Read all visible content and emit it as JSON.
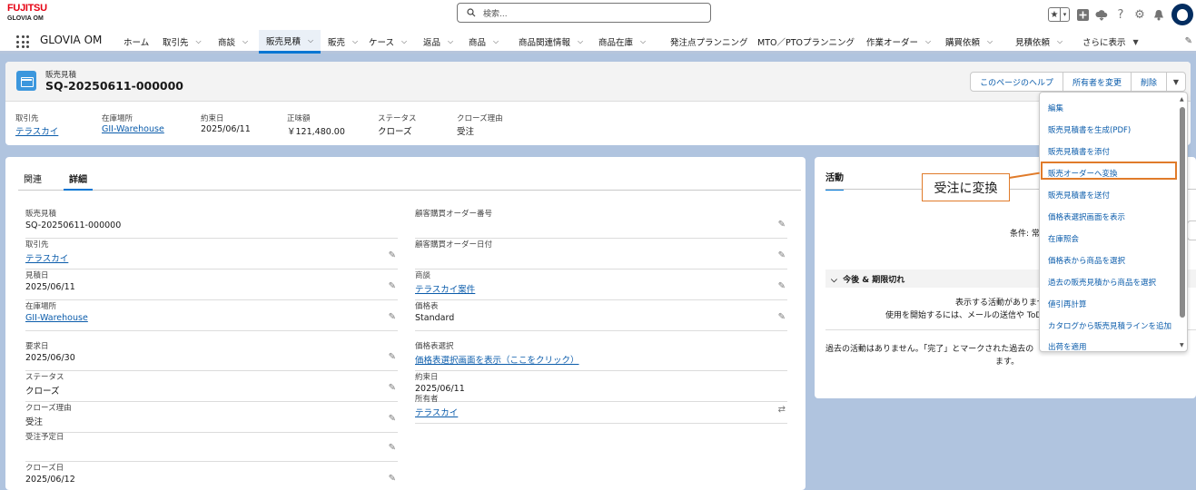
{
  "header": {
    "logo_brand": "FUJITSU",
    "logo_sub": "GLOVIA OM",
    "search_placeholder": "検索...",
    "icons": [
      "star-icon",
      "chevron-down-icon",
      "plus-icon",
      "cloud-icon",
      "help-icon",
      "gear-icon",
      "bell-icon",
      "avatar"
    ]
  },
  "nav": {
    "app_name": "GLOVIA OM",
    "items": [
      {
        "label": "ホーム",
        "chev": false
      },
      {
        "label": "取引先",
        "chev": true
      },
      {
        "label": "商談",
        "chev": true
      },
      {
        "label": "販売見積",
        "chev": true,
        "active": true
      },
      {
        "label": "販売",
        "chev": true
      },
      {
        "label": "ケース",
        "chev": true
      },
      {
        "label": "返品",
        "chev": true
      },
      {
        "label": "商品",
        "chev": true
      },
      {
        "label": "商品関連情報",
        "chev": true
      },
      {
        "label": "商品在庫",
        "chev": true
      },
      {
        "label": "発注点プランニング",
        "chev": false
      },
      {
        "label": "MTO／PTOプランニング",
        "chev": false
      },
      {
        "label": "作業オーダー",
        "chev": true
      },
      {
        "label": "購買依頼",
        "chev": true
      },
      {
        "label": "見積依頼",
        "chev": true
      },
      {
        "label": "さらに表示",
        "chev": true
      }
    ]
  },
  "record": {
    "object_label": "販売見積",
    "title": "SQ-20250611-000000",
    "buttons": {
      "help": "このページのヘルプ",
      "change_owner": "所有者を変更",
      "delete": "削除"
    },
    "highlights": [
      {
        "label": "取引先",
        "value": "テラスカイ",
        "link": true
      },
      {
        "label": "在庫場所",
        "value": "GII-Warehouse",
        "link": true
      },
      {
        "label": "約束日",
        "value": "2025/06/11",
        "link": false
      },
      {
        "label": "正味額",
        "value": "￥121,480.00",
        "link": false
      },
      {
        "label": "ステータス",
        "value": "クローズ",
        "link": false
      },
      {
        "label": "クローズ理由",
        "value": "受注",
        "link": false
      }
    ]
  },
  "detail": {
    "tabs": [
      "関連",
      "詳細"
    ],
    "left_fields": [
      {
        "label": "販売見積",
        "value": "SQ-20250611-000000",
        "link": false,
        "edit": false
      },
      {
        "label": "取引先",
        "value": "テラスカイ",
        "link": true,
        "edit": true
      },
      {
        "label": "見積日",
        "value": "2025/06/11",
        "link": false,
        "edit": true
      },
      {
        "label": "在庫場所",
        "value": "GII-Warehouse",
        "link": true,
        "edit": true
      },
      {
        "label": "要求日",
        "value": "2025/06/30",
        "link": false,
        "edit": true
      },
      {
        "label": "ステータス",
        "value": "クローズ",
        "link": false,
        "edit": true
      },
      {
        "label": "クローズ理由",
        "value": "受注",
        "link": false,
        "edit": true
      },
      {
        "label": "受注予定日",
        "value": "",
        "link": false,
        "edit": true
      },
      {
        "label": "クローズ日",
        "value": "2025/06/12",
        "link": false,
        "edit": true
      }
    ],
    "right_fields": [
      {
        "label": "顧客購買オーダー番号",
        "value": "",
        "link": false,
        "edit": true
      },
      {
        "label": "顧客購買オーダー日付",
        "value": "",
        "link": false,
        "edit": true
      },
      {
        "label": "商談",
        "value": "テラスカイ案件",
        "link": true,
        "edit": true
      },
      {
        "label": "価格表",
        "value": "Standard",
        "link": false,
        "edit": true
      },
      {
        "label": "価格表選択",
        "value": "価格表選択画面を表示（ここをクリック）",
        "link": true,
        "edit": false
      },
      {
        "label": "約束日",
        "value": "2025/06/11",
        "link": false,
        "edit": false
      },
      {
        "label": "所有者",
        "value": "テラスカイ",
        "link": true,
        "edit": "owner"
      }
    ]
  },
  "activity": {
    "tab": "活動",
    "filter_text": "条件: 常",
    "section": "今後 & 期限切れ",
    "empty_line1": "表示する活動がありませ",
    "empty_line2": "使用を開始するには、メールの送信や ToDo のスケ",
    "past_line1": "過去の活動はありません。「完了」とマークされた過去の",
    "past_line2": "ます。"
  },
  "menu": {
    "items": [
      "編集",
      "販売見積書を生成(PDF)",
      "販売見積書を添付",
      "販売オーダーへ変換",
      "販売見積書を送付",
      "価格表選択画面を表示",
      "在庫照会",
      "価格表から商品を選択",
      "過去の販売見積から商品を選択",
      "値引再計算",
      "カタログから販売見積ラインを追加",
      "出荷を適用"
    ],
    "highlighted_index": 3
  },
  "callout": {
    "text": "受注に変換"
  },
  "colors": {
    "accent": "#0176d3",
    "link": "#0b5cab",
    "callout": "#e07b2a",
    "background": "#b0c4df"
  }
}
